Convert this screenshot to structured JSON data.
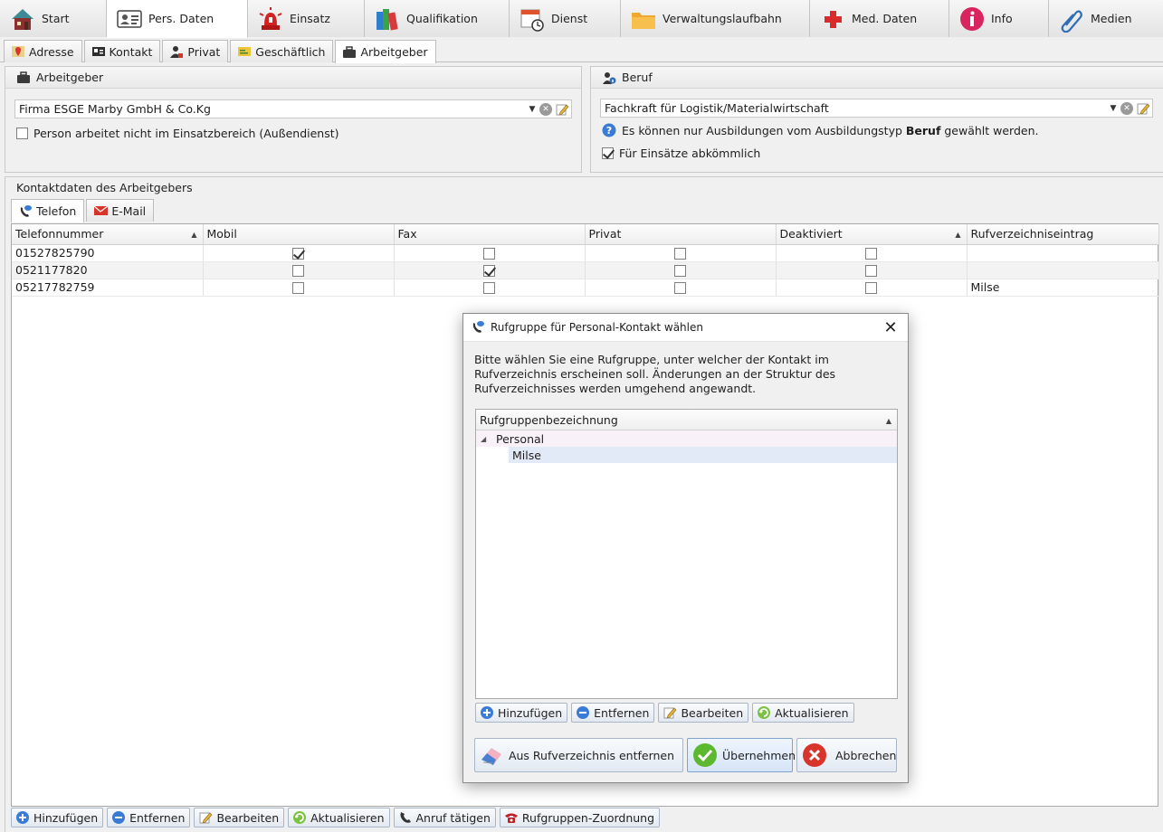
{
  "main_tabs": [
    {
      "label": "Start",
      "icon": "house-icon"
    },
    {
      "label": "Pers. Daten",
      "icon": "id-card-icon"
    },
    {
      "label": "Einsatz",
      "icon": "alarm-light-icon"
    },
    {
      "label": "Qualifikation",
      "icon": "books-icon"
    },
    {
      "label": "Dienst",
      "icon": "calendar-clock-icon"
    },
    {
      "label": "Verwaltungslaufbahn",
      "icon": "folder-icon"
    },
    {
      "label": "Med. Daten",
      "icon": "red-cross-icon"
    },
    {
      "label": "Info",
      "icon": "info-icon"
    },
    {
      "label": "Medien",
      "icon": "paperclip-icon"
    }
  ],
  "sub_tabs": [
    {
      "label": "Adresse"
    },
    {
      "label": "Kontakt"
    },
    {
      "label": "Privat"
    },
    {
      "label": "Geschäftlich"
    },
    {
      "label": "Arbeitgeber"
    }
  ],
  "employer": {
    "title": "Arbeitgeber",
    "value": "Firma ESGE Marby GmbH & Co.Kg",
    "field_checkbox_label": "Person arbeitet nicht im Einsatzbereich (Außendienst)",
    "field_checkbox_checked": false
  },
  "profession": {
    "title": "Beruf",
    "value": "Fachkraft für Logistik/Materialwirtschaft",
    "hint_before": "Es können nur Ausbildungen vom Ausbildungstyp ",
    "hint_bold": "Beruf",
    "hint_after": " gewählt werden.",
    "available_label": "Für Einsätze abkömmlich",
    "available_checked": true
  },
  "contact": {
    "title": "Kontaktdaten des Arbeitgebers",
    "tabs": [
      {
        "label": "Telefon"
      },
      {
        "label": "E-Mail"
      }
    ],
    "columns": [
      "Telefonnummer",
      "Mobil",
      "Fax",
      "Privat",
      "Deaktiviert",
      "Rufverzeichniseintrag"
    ],
    "rows": [
      {
        "number": "01527825790",
        "mobil": true,
        "fax": false,
        "privat": false,
        "deaktiviert": false,
        "entry": ""
      },
      {
        "number": "0521177820",
        "mobil": false,
        "fax": true,
        "privat": false,
        "deaktiviert": false,
        "entry": ""
      },
      {
        "number": "05217782759",
        "mobil": false,
        "fax": false,
        "privat": false,
        "deaktiviert": false,
        "entry": "Milse"
      }
    ]
  },
  "toolbar": {
    "add": "Hinzufügen",
    "remove": "Entfernen",
    "edit": "Bearbeiten",
    "refresh": "Aktualisieren",
    "call": "Anruf tätigen",
    "group_assign": "Rufgruppen-Zuordnung"
  },
  "dialog": {
    "title": "Rufgruppe für Personal-Kontakt wählen",
    "message": "Bitte wählen Sie eine Rufgruppe, unter welcher der Kontakt im Rufverzeichnis erscheinen soll. Änderungen an der Struktur des Rufverzeichnisses werden umgehend angewandt.",
    "tree_header": "Rufgruppenbezeichnung",
    "tree": {
      "parent": "Personal",
      "child": "Milse"
    },
    "toolbar": {
      "add": "Hinzufügen",
      "remove": "Entfernen",
      "edit": "Bearbeiten",
      "refresh": "Aktualisieren"
    },
    "remove_from_directory": "Aus Rufverzeichnis entfernen",
    "apply": "Übernehmen",
    "cancel": "Abbrechen"
  },
  "colors": {
    "accent_blue": "#3a7bd5",
    "button_border": "#a9b6c8",
    "selected_row": "#e3eaf7",
    "ok_green": "#5cb82e",
    "cancel_red": "#d9342b"
  }
}
